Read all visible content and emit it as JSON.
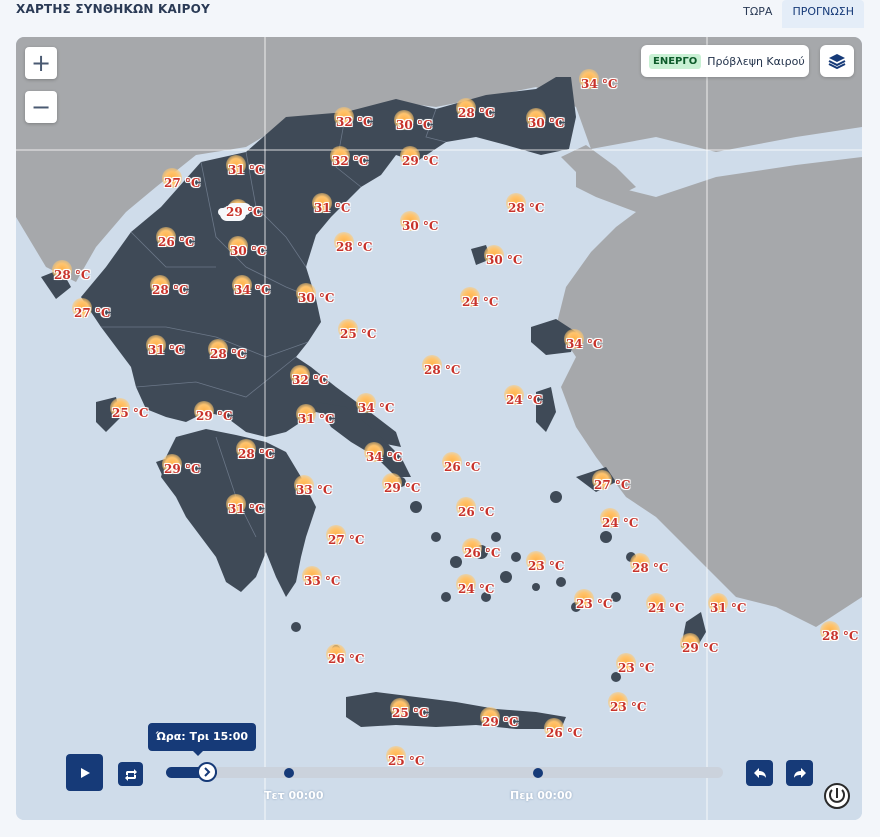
{
  "header": {
    "title": "ΧΑΡΤΗΣ ΣΥΝΘΗΚΩΝ ΚΑΙΡΟΥ",
    "tabs": [
      {
        "label": "ΤΩΡΑ",
        "active": false
      },
      {
        "label": "ΠΡΟΓΝΩΣΗ",
        "active": true
      }
    ]
  },
  "map_controls": {
    "zoom_in": "+",
    "zoom_out": "−",
    "status_badge": "ΕΝΕΡΓΟ",
    "forecast_label": "Πρόβλεψη Καιρού",
    "layers_icon": "layers-icon"
  },
  "weather_markers": [
    {
      "temp": "34 °C",
      "icon": "sun"
    },
    {
      "temp": "28 °C",
      "icon": "sun"
    },
    {
      "temp": "32 °C",
      "icon": "sun"
    },
    {
      "temp": "30 °C",
      "icon": "sun"
    },
    {
      "temp": "30 °C",
      "icon": "sun"
    },
    {
      "temp": "31 °C",
      "icon": "sun"
    },
    {
      "temp": "32 °C",
      "icon": "sun"
    },
    {
      "temp": "29 °C",
      "icon": "sun"
    },
    {
      "temp": "27 °C",
      "icon": "sun"
    },
    {
      "temp": "29 °C",
      "icon": "cloud"
    },
    {
      "temp": "31 °C",
      "icon": "sun"
    },
    {
      "temp": "28 °C",
      "icon": "sun"
    },
    {
      "temp": "26 °C",
      "icon": "sun"
    },
    {
      "temp": "30 °C",
      "icon": "sun"
    },
    {
      "temp": "30 °C",
      "icon": "sun"
    },
    {
      "temp": "28 °C",
      "icon": "sun"
    },
    {
      "temp": "28 °C",
      "icon": "sun"
    },
    {
      "temp": "30 °C",
      "icon": "sun"
    },
    {
      "temp": "28 °C",
      "icon": "sun"
    },
    {
      "temp": "34 °C",
      "icon": "sun"
    },
    {
      "temp": "30 °C",
      "icon": "sun"
    },
    {
      "temp": "24 °C",
      "icon": "sun"
    },
    {
      "temp": "27 °C",
      "icon": "sun"
    },
    {
      "temp": "25 °C",
      "icon": "sun"
    },
    {
      "temp": "31 °C",
      "icon": "sun"
    },
    {
      "temp": "28 °C",
      "icon": "sun"
    },
    {
      "temp": "34 °C",
      "icon": "sun"
    },
    {
      "temp": "32 °C",
      "icon": "sun"
    },
    {
      "temp": "28 °C",
      "icon": "sun"
    },
    {
      "temp": "25 °C",
      "icon": "sun"
    },
    {
      "temp": "29 °C",
      "icon": "sun"
    },
    {
      "temp": "31 °C",
      "icon": "sun"
    },
    {
      "temp": "34 °C",
      "icon": "sun"
    },
    {
      "temp": "24 °C",
      "icon": "sun"
    },
    {
      "temp": "28 °C",
      "icon": "sun"
    },
    {
      "temp": "34 °C",
      "icon": "sun"
    },
    {
      "temp": "26 °C",
      "icon": "sun"
    },
    {
      "temp": "29 °C",
      "icon": "sun"
    },
    {
      "temp": "33 °C",
      "icon": "sun"
    },
    {
      "temp": "29 °C",
      "icon": "sun"
    },
    {
      "temp": "26 °C",
      "icon": "sun"
    },
    {
      "temp": "27 °C",
      "icon": "sun"
    },
    {
      "temp": "31 °C",
      "icon": "sun"
    },
    {
      "temp": "27 °C",
      "icon": "sun"
    },
    {
      "temp": "24 °C",
      "icon": "sun"
    },
    {
      "temp": "26 °C",
      "icon": "sun"
    },
    {
      "temp": "23 °C",
      "icon": "sun"
    },
    {
      "temp": "28 °C",
      "icon": "sun"
    },
    {
      "temp": "33 °C",
      "icon": "sun"
    },
    {
      "temp": "24 °C",
      "icon": "sun"
    },
    {
      "temp": "23 °C",
      "icon": "sun"
    },
    {
      "temp": "24 °C",
      "icon": "sun"
    },
    {
      "temp": "31 °C",
      "icon": "sun"
    },
    {
      "temp": "29 °C",
      "icon": "sun"
    },
    {
      "temp": "28 °C",
      "icon": "sun"
    },
    {
      "temp": "26 °C",
      "icon": "sun"
    },
    {
      "temp": "23 °C",
      "icon": "sun"
    },
    {
      "temp": "23 °C",
      "icon": "sun"
    },
    {
      "temp": "25 °C",
      "icon": "sun"
    },
    {
      "temp": "29 °C",
      "icon": "sun"
    },
    {
      "temp": "26 °C",
      "icon": "sun"
    },
    {
      "temp": "25 °C",
      "icon": "sun"
    }
  ],
  "timeline": {
    "tooltip": "Ώρα: Τρι 15:00",
    "progress_fraction": 0.055,
    "day_labels": [
      "Τετ 00:00",
      "Πεμ 00:00"
    ],
    "play_icon": "play-icon",
    "repeat_icon": "repeat-icon",
    "back_icon": "undo-icon",
    "forward_icon": "redo-icon"
  },
  "colors": {
    "accent": "#163a78",
    "land_greece": "#3f4a57",
    "land_other": "#a6a8ab",
    "sea": "#cfdcea",
    "temperature_text": "#c8322a"
  }
}
